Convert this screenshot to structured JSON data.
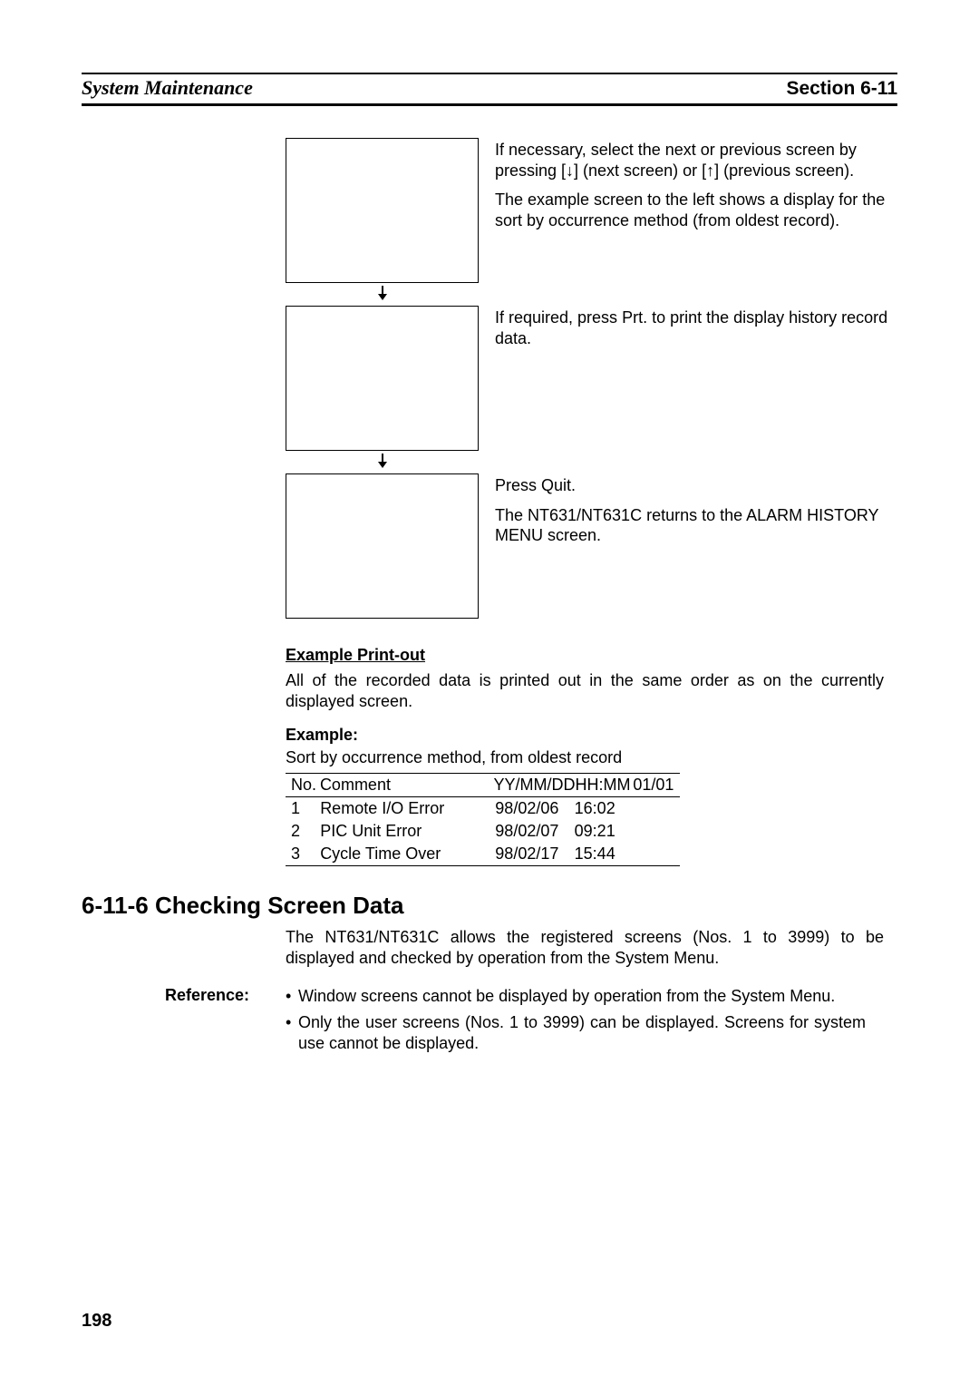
{
  "header": {
    "left": "System Maintenance",
    "right": "Section 6-11"
  },
  "flow": {
    "step1_p1": "If necessary, select the next or previous screen by pressing [↓] (next screen) or [↑] (previous screen).",
    "step1_p2": "The example screen to the left shows a display for the sort by occurrence method (from oldest record).",
    "step2_p1": "If required, press Prt. to print the display history record data.",
    "step3_p1": "Press Quit.",
    "step3_p2": "The NT631/NT631C returns to the ALARM HISTORY MENU screen."
  },
  "example_heading": "Example Print-out",
  "example_body": "All of the recorded data is printed out in the same order as on the currently displayed screen.",
  "example_label": "Example:",
  "example_caption": "Sort by occurrence method, from oldest record",
  "table": {
    "headers": {
      "no": "No.",
      "comment": "Comment",
      "date": "YY/MM/DD",
      "time": "HH:MM",
      "page": "01/01"
    },
    "rows": [
      {
        "no": "1",
        "comment": "Remote I/O Error",
        "date": "98/02/06",
        "time": "16:02",
        "page": ""
      },
      {
        "no": "2",
        "comment": "PIC Unit Error",
        "date": "98/02/07",
        "time": "09:21",
        "page": ""
      },
      {
        "no": "3",
        "comment": "Cycle Time Over",
        "date": "98/02/17",
        "time": "15:44",
        "page": ""
      }
    ]
  },
  "section_heading": "6-11-6  Checking Screen Data",
  "section_body": "The NT631/NT631C allows the registered screens (Nos. 1 to 3999) to be displayed and checked by operation from the System Menu.",
  "reference": {
    "label": "Reference:",
    "items": [
      "Window screens cannot be displayed by operation from the System Menu.",
      "Only the user screens (Nos. 1 to 3999) can be displayed. Screens for system use cannot be displayed."
    ]
  },
  "page_number": "198"
}
